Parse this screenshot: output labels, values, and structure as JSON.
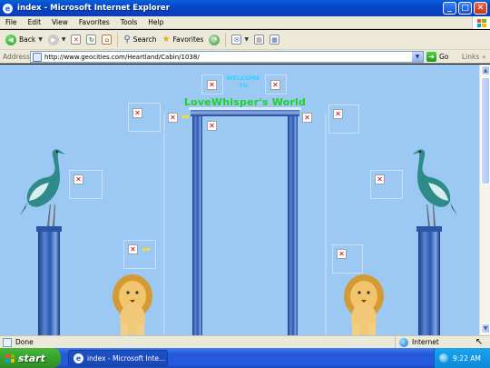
{
  "window": {
    "title": "index - Microsoft Internet Explorer"
  },
  "menubar": {
    "items": [
      "File",
      "Edit",
      "View",
      "Favorites",
      "Tools",
      "Help"
    ]
  },
  "toolbar": {
    "back_label": "Back",
    "search_label": "Search",
    "favorites_label": "Favorites"
  },
  "addressbar": {
    "label": "Address",
    "url": "http://www.geocities.com/Heartland/Cabin/1038/",
    "go_label": "Go",
    "links_label": "Links"
  },
  "page": {
    "welcome_line1": "WELCOME",
    "welcome_line2": "TO",
    "site_title": "LoveWhisper's World"
  },
  "status": {
    "text": "Done",
    "zone": "Internet"
  },
  "taskbar": {
    "start_label": "start",
    "task_label": "index - Microsoft Inte...",
    "clock": "9:22 AM"
  },
  "colors": {
    "page_bg": "#9cc8f4",
    "title_green": "#1fd21f",
    "welcome_cyan": "#2fd2ff"
  }
}
